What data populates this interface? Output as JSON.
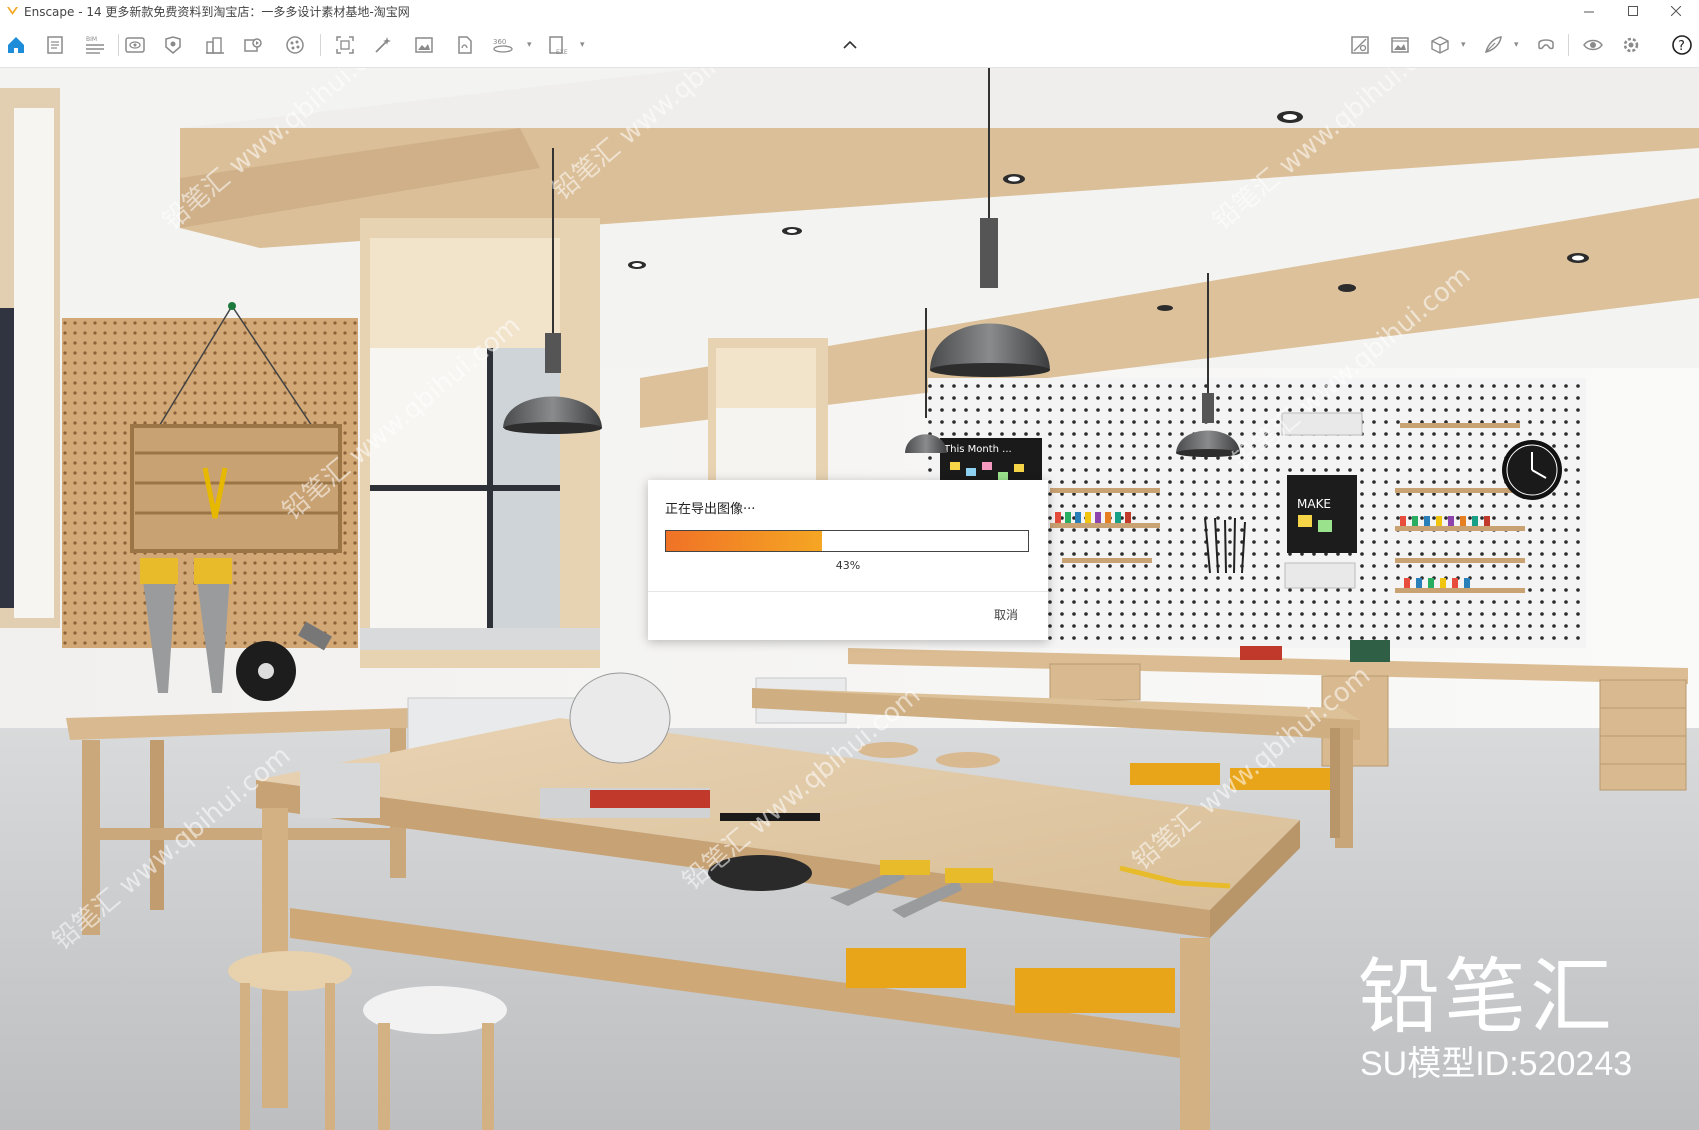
{
  "window": {
    "title": "Enscape - 14   更多新款免费资料到淘宝店：一多多设计素材基地-淘宝网",
    "minimize_icon": "minimize-icon",
    "maximize_icon": "maximize-icon",
    "close_icon": "close-icon"
  },
  "toolbar": {
    "left_icons": [
      "home-icon",
      "document-icon",
      "bim-icon",
      "view-icon",
      "asset-library-icon",
      "site-context-icon",
      "video-editor-icon",
      "material-editor-icon",
      "screenshot-icon",
      "batch-render-icon",
      "image-export-icon",
      "panorama-icon",
      "360-icon",
      "exe-export-icon"
    ],
    "bim_label": "BIM",
    "pano_label": "360",
    "exe_label": "EXE",
    "collapse_icon": "chevron-up-icon",
    "right_icons": [
      "sync-views-icon",
      "gallery-icon",
      "cube-icon",
      "feather-icon",
      "vr-headset-icon",
      "eye-icon",
      "settings-icon",
      "help-icon"
    ],
    "help_label": "?"
  },
  "dialog": {
    "title": "正在导出图像···",
    "progress": 0.43,
    "progress_text": "43%",
    "cancel_label": "取消",
    "accent_start": "#f07226",
    "accent_end": "#f5a623"
  },
  "scene_signs": {
    "board_title": "This Month ...",
    "poster_text": "MAKE"
  },
  "watermark": {
    "brand": "铅笔汇",
    "model_id": "SU模型ID:520243",
    "repeat_text": "铅笔汇 www.qbihui.com"
  }
}
